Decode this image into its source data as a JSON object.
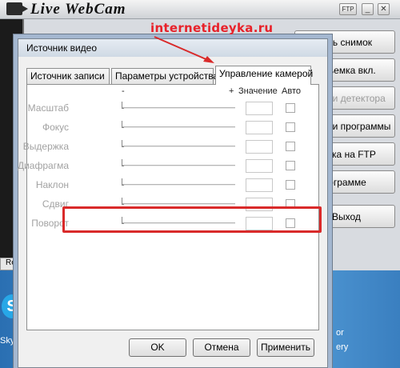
{
  "app": {
    "title": "Live WebCam",
    "buttons": [
      "лать снимок",
      "осъемка вкл.",
      "ойки детектора",
      "ойки программы",
      "рузка на FTP",
      "программе",
      "Выход"
    ],
    "status_text": "Re",
    "window_controls": [
      "FTP",
      "minimize-icon",
      "close-icon"
    ]
  },
  "watermark": "internetideyka.ru",
  "desktop": {
    "icon_label": "Skyp",
    "right_text_1": "or",
    "right_text_2": "ery"
  },
  "dialog": {
    "title": "Источник видео",
    "tabs": [
      {
        "label": "Источник записи",
        "active": false
      },
      {
        "label": "Параметры устройства",
        "active": false
      },
      {
        "label": "Управление камерой",
        "active": true
      }
    ],
    "headers": {
      "minus": "-",
      "plus": "+",
      "value": "Значение",
      "auto": "Авто"
    },
    "rows": [
      {
        "label": "Масштаб"
      },
      {
        "label": "Фокус"
      },
      {
        "label": "Выдержка"
      },
      {
        "label": "Диафрагма"
      },
      {
        "label": "Наклон"
      },
      {
        "label": "Сдвиг"
      },
      {
        "label": "Поворот"
      }
    ],
    "buttons": {
      "ok": "OK",
      "cancel": "Отмена",
      "apply": "Применить"
    }
  },
  "colors": {
    "highlight": "#d92a2a",
    "watermark": "#e8222a",
    "disabled_text": "#a2a2a2"
  }
}
